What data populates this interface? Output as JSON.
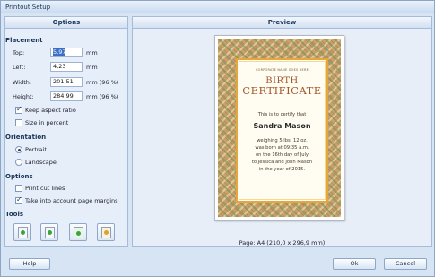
{
  "window": {
    "title": "Printout Setup"
  },
  "left_pane": {
    "header": "Options",
    "placement": {
      "title": "Placement",
      "top": {
        "label": "Top:",
        "value": "5,97",
        "unit": "mm"
      },
      "left": {
        "label": "Left:",
        "value": "4,23",
        "unit": "mm"
      },
      "width": {
        "label": "Width:",
        "value": "201,51",
        "unit": "mm (96 %)"
      },
      "height": {
        "label": "Height:",
        "value": "284,99",
        "unit": "mm (96 %)"
      },
      "keep_aspect": {
        "label": "Keep aspect ratio",
        "checked": true
      },
      "size_percent": {
        "label": "Size in percent",
        "checked": false
      }
    },
    "orientation": {
      "title": "Orientation",
      "portrait": {
        "label": "Portrait",
        "selected": true
      },
      "landscape": {
        "label": "Landscape",
        "selected": false
      }
    },
    "options": {
      "title": "Options",
      "print_cut_lines": {
        "label": "Print cut lines",
        "checked": false
      },
      "margins": {
        "label": "Take into account page margins",
        "checked": true
      }
    },
    "tools": {
      "title": "Tools",
      "buttons": [
        "fit-page-icon",
        "center-page-icon",
        "move-arrows-icon",
        "reset-icon"
      ]
    }
  },
  "right_pane": {
    "header": "Preview",
    "certificate": {
      "org": "CORPORATE NAME GOES HERE",
      "title_line1": "BIRTH",
      "title_line2": "CERTIFICATE",
      "certify": "This is to certify that",
      "name": "Sandra Mason",
      "body": [
        "weighing 5 lbs. 12 oz.",
        "was born at 09:35 a.m.",
        "on the 16th day of July",
        "to Jessica and John Mason",
        "in the year of 2015."
      ]
    },
    "page_info": "Page: A4 (210,0 x 296,9 mm)"
  },
  "buttons": {
    "help": "Help",
    "ok": "Ok",
    "cancel": "Cancel"
  },
  "colors": {
    "accent": "#3a6fc7",
    "frame_border": "#e6a63a",
    "title_color": "#a5562c"
  }
}
